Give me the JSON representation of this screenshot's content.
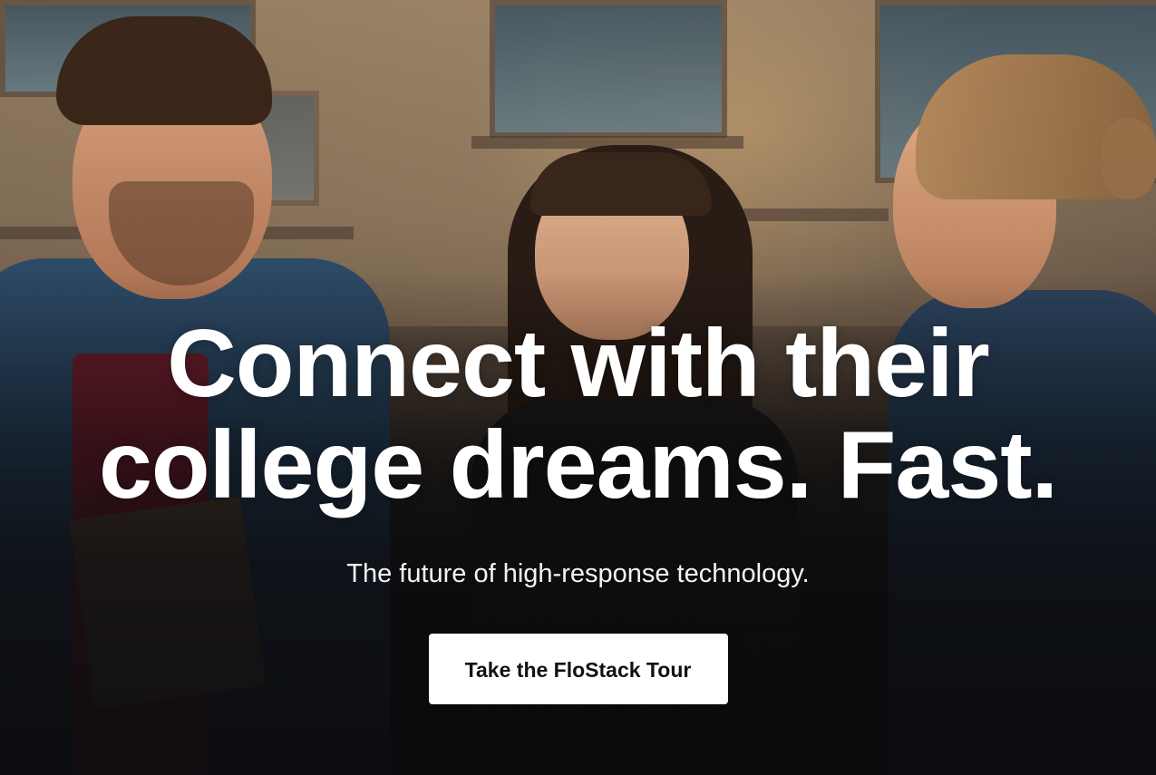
{
  "hero": {
    "headline_line1": "Connect with their",
    "headline_line2": "college dreams. Fast.",
    "subheadline": "The future of high-response technology.",
    "cta_label": "Take the FloStack Tour"
  },
  "colors": {
    "text": "#ffffff",
    "button_bg": "#ffffff",
    "button_text": "#111111",
    "overlay_dark": "#0f0f10"
  },
  "background": {
    "image_description_icon": "hero-photo"
  }
}
